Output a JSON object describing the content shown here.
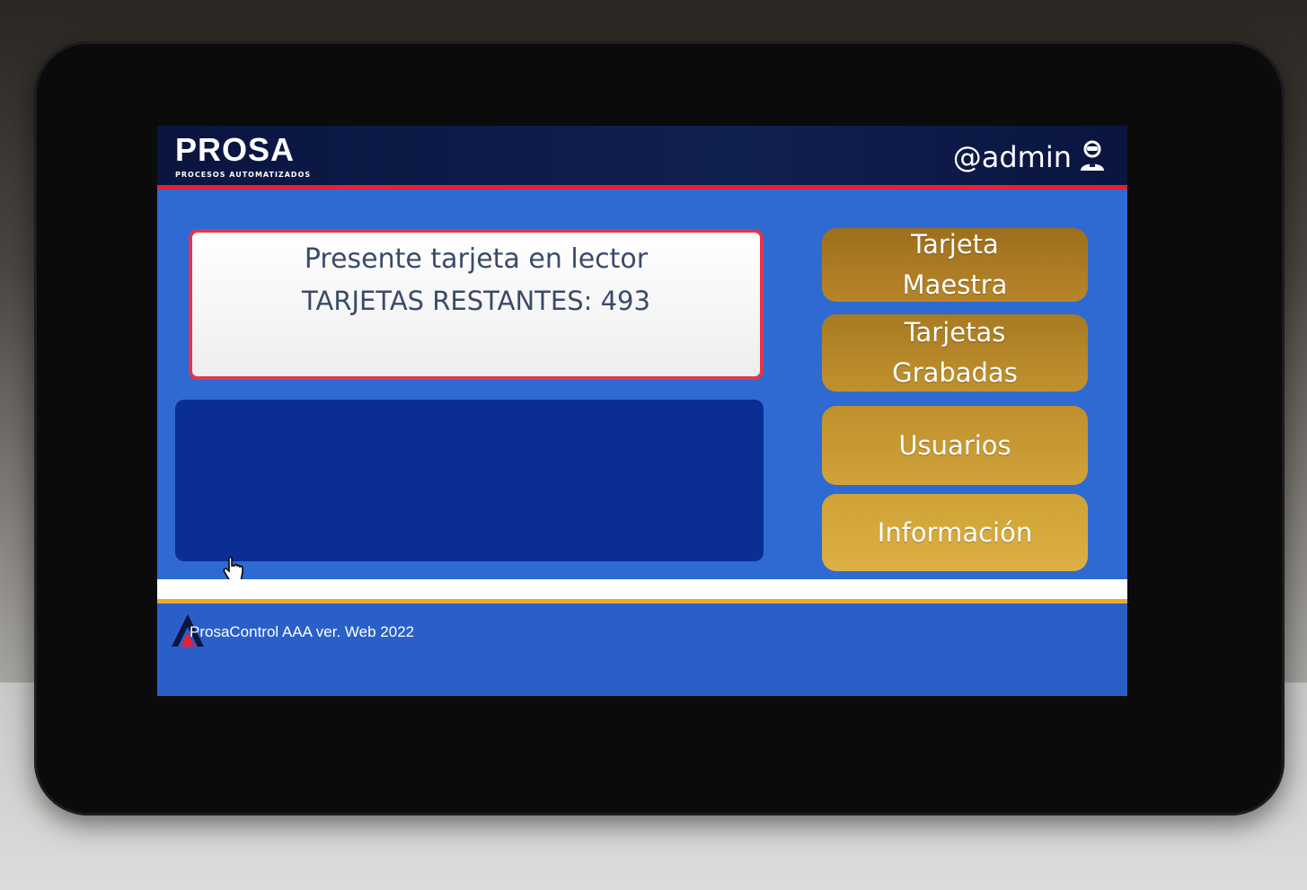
{
  "header": {
    "brand": "PROSA",
    "tagline": "PROCESOS AUTOMATIZADOS",
    "user": "@admin",
    "user_icon": "user-icon"
  },
  "message": {
    "line1": "Presente tarjeta en lector",
    "line2": "TARJETAS RESTANTES: 493"
  },
  "menu": {
    "items": [
      {
        "line1": "Tarjeta",
        "line2": "Maestra"
      },
      {
        "line1": "Tarjetas",
        "line2": "Grabadas"
      },
      {
        "line1": "Usuarios"
      },
      {
        "line1": "Información"
      }
    ]
  },
  "footer": {
    "version": "ProsaControl AAA ver. Web 2022",
    "logo_icon": "prosa-triangle-logo"
  },
  "colors": {
    "screen_bg": "#2f6ad2",
    "header_bg": "#10204f",
    "accent_red": "#e2213a",
    "panel_dark": "#0b2e94",
    "button_gold": "#c0922e"
  }
}
